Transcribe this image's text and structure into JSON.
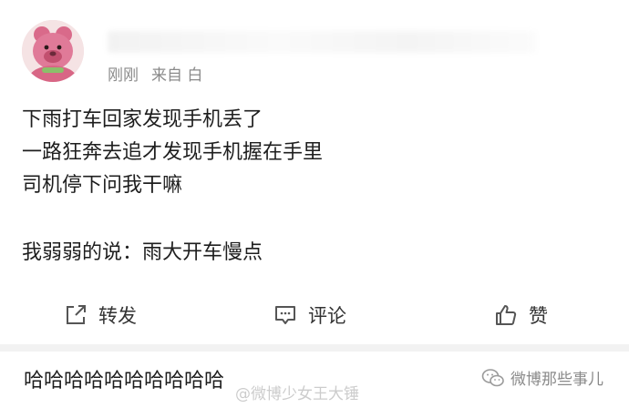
{
  "post": {
    "meta": {
      "time": "刚刚",
      "source": "来自",
      "source_suffix": "白"
    },
    "lines": [
      "下雨打车回家发现手机丢了",
      "一路狂奔去追才发现手机握在手里",
      "司机停下问我干嘛",
      "我弱弱的说：雨大开车慢点"
    ]
  },
  "actions": {
    "repost_label": "转发",
    "comment_label": "评论",
    "like_label": "赞"
  },
  "reply": {
    "text": "哈哈哈哈哈哈哈哈哈哈"
  },
  "watermarks": {
    "center": "@微博少女王大锤",
    "right": "微博那些事儿"
  },
  "icons": {
    "repost": "share-arrow-icon",
    "comment": "comment-bubble-icon",
    "like": "thumbs-up-icon",
    "wechat": "wechat-icon"
  },
  "colors": {
    "meta_text": "#8a8a8a",
    "divider": "#f2f2f2",
    "avatar_bg": "#f3dadc"
  }
}
